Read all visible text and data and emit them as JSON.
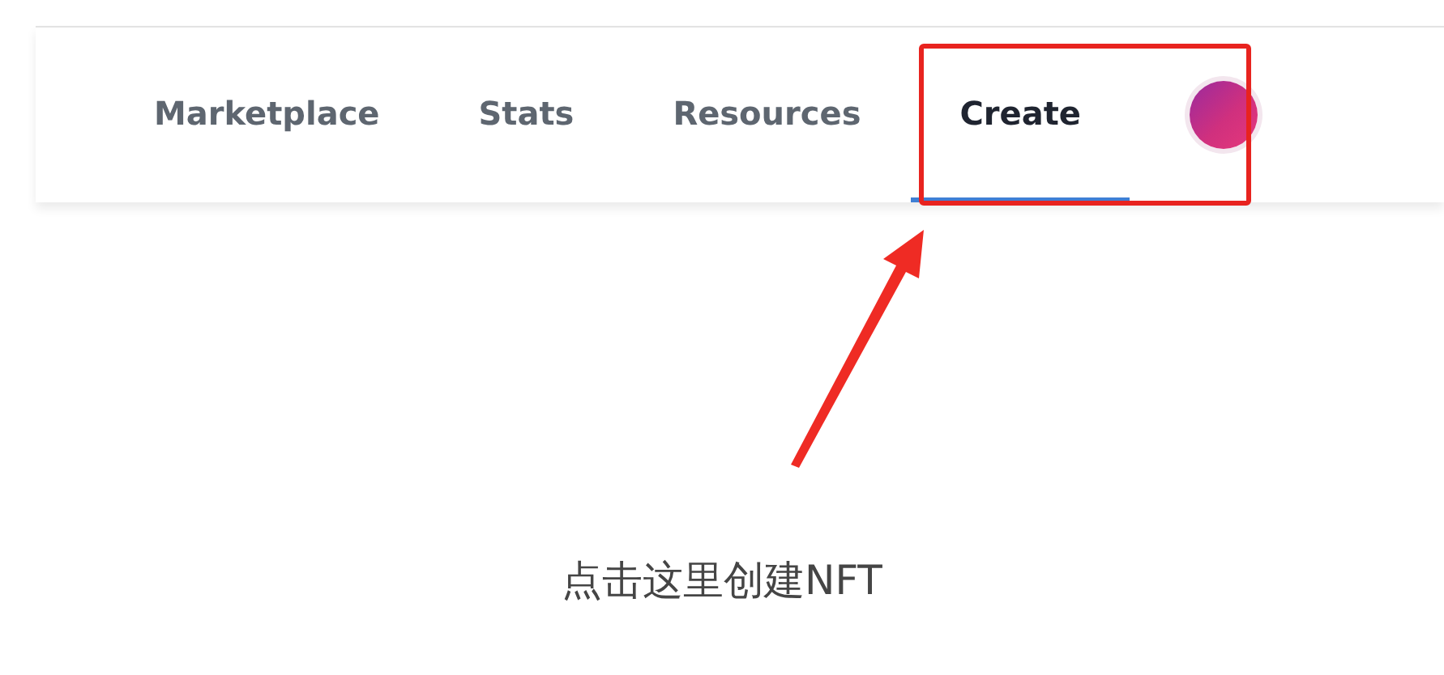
{
  "nav": {
    "tabs": [
      {
        "label": "Marketplace",
        "selected": false
      },
      {
        "label": "Stats",
        "selected": false
      },
      {
        "label": "Resources",
        "selected": false
      },
      {
        "label": "Create",
        "selected": true
      }
    ]
  },
  "annotation": {
    "caption": "点击这里创建NFT"
  }
}
